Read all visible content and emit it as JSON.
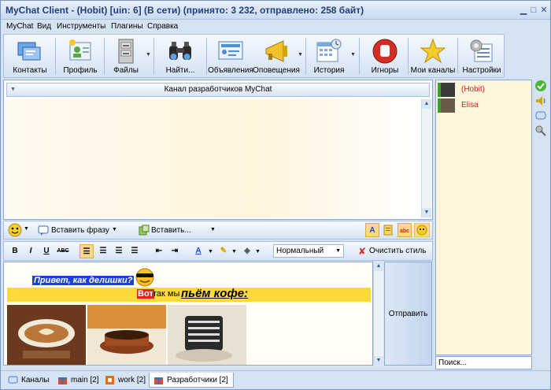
{
  "window": {
    "title": "MyChat Client - (Hobit) [uin: 6] (В сети) (принято: 3 232, отправлено: 258 байт)"
  },
  "menu": [
    "MyChat",
    "Вид",
    "Инструменты",
    "Плагины",
    "Справка"
  ],
  "toolbar": [
    {
      "label": "Контакты",
      "icon": "contacts-icon"
    },
    {
      "label": "Профиль",
      "icon": "profile-icon"
    },
    {
      "label": "Файлы",
      "icon": "files-icon"
    },
    {
      "label": "Найти...",
      "icon": "binoculars-icon"
    },
    {
      "label": "Объявления",
      "icon": "announcements-icon"
    },
    {
      "label": "Оповещения",
      "icon": "megaphone-icon"
    },
    {
      "label": "История",
      "icon": "history-icon"
    },
    {
      "label": "Игноры",
      "icon": "ignore-icon"
    },
    {
      "label": "Мои каналы",
      "icon": "star-icon"
    },
    {
      "label": "Настройки",
      "icon": "settings-icon"
    }
  ],
  "channel": {
    "header": "Канал разработчиков MyChat"
  },
  "toolbar2": {
    "insert_phrase": "Вставить фразу",
    "insert": "Вставить..."
  },
  "format": {
    "bold": "B",
    "italic": "I",
    "underline": "U",
    "strike": "ABC",
    "style_select": "Нормальный",
    "clear_style": "Очистить стиль"
  },
  "message": {
    "greeting": "Привет, как делишки?",
    "vot": "Вот",
    "middle": "так мы",
    "coffee": "пьём кофе:"
  },
  "send_button": "Отправить",
  "users": [
    {
      "name": "(Hobit)"
    },
    {
      "name": "Elisa"
    }
  ],
  "search_placeholder": "Поиск...",
  "tabs": [
    {
      "label": "Каналы",
      "active": false
    },
    {
      "label": "main [2]",
      "active": false
    },
    {
      "label": "work [2]",
      "active": false
    },
    {
      "label": "Разработчики [2]",
      "active": true
    }
  ],
  "colors": {
    "accent": "#1e3f79",
    "highlight": "#ffd93a",
    "online": "#2fa52a"
  }
}
